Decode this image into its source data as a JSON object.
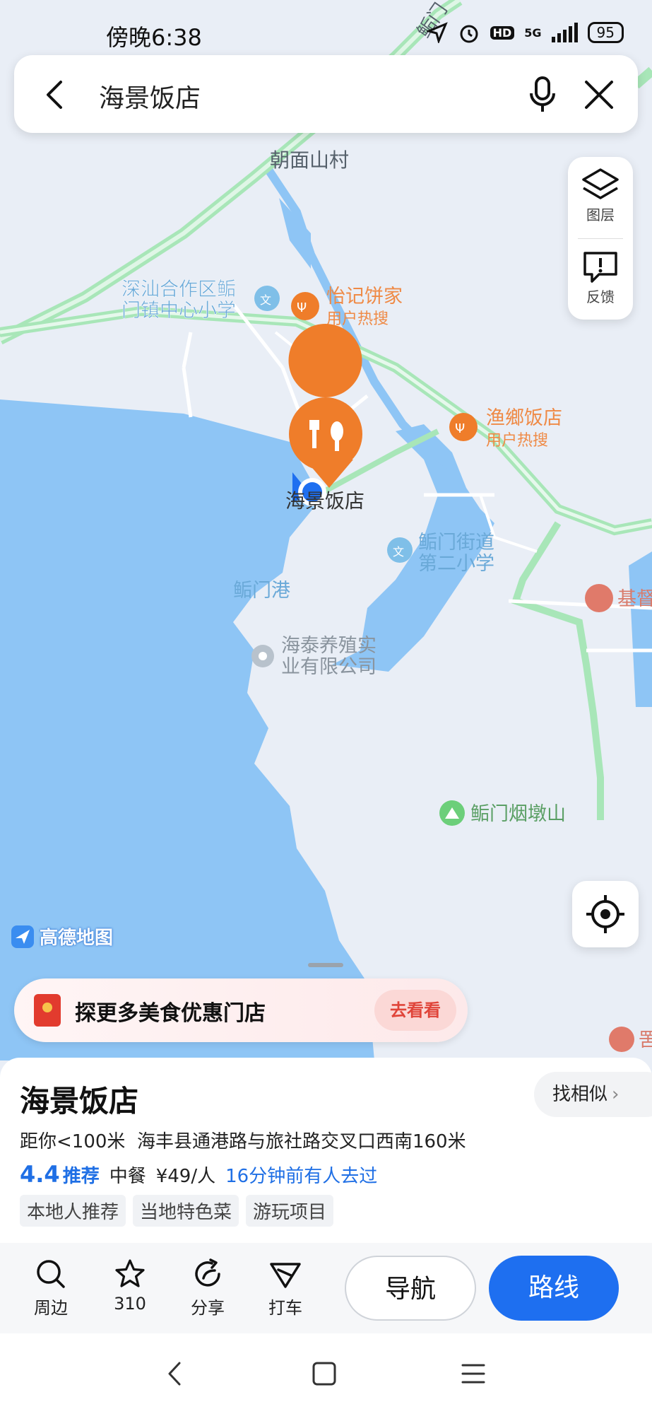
{
  "status_bar": {
    "time": "傍晚6:38",
    "network": "5G",
    "hd": "HD",
    "battery": "95"
  },
  "search": {
    "query": "海景饭店"
  },
  "map": {
    "labels": {
      "village": "朝面山村",
      "school1": "深汕合作区鲘\n门镇中心小学",
      "yiji": "怡记饼家",
      "yiji_sub": "用户热搜",
      "yuxiang": "渔鄉饭店",
      "yuxiang_sub": "用户热搜",
      "haijing": "海景饭店",
      "school2": "鲘门街道\n第二小学",
      "port": "鲘门港",
      "company": "海泰养殖实\n业有限公司",
      "mountain": "鲘门烟墩山",
      "edge_right": "基督",
      "edge_bottom": "罟",
      "road_top": "鲘门"
    },
    "colors": {
      "water": "#8ec5f5",
      "land": "#e9eef6",
      "road": "#a8e6b8",
      "poi": "#ef7d2a",
      "accent": "#1e6ff0"
    }
  },
  "side_panel": {
    "layers": "图层",
    "feedback": "反馈"
  },
  "logo": "高德地图",
  "promo": {
    "text": "探更多美食优惠门店",
    "button": "去看看"
  },
  "place": {
    "name": "海景饭店",
    "similar": "找相似",
    "distance": "距你<100米",
    "address": "海丰县通港路与旅社路交叉口西南160米",
    "rating": "4.4",
    "rating_label": "推荐",
    "category": "中餐",
    "price": "¥49/人",
    "recent": "16分钟前有人去过",
    "tags": [
      "本地人推荐",
      "当地特色菜",
      "游玩项目"
    ]
  },
  "actions": {
    "nearby": "周边",
    "favorite": "310",
    "share": "分享",
    "taxi": "打车",
    "navigate": "导航",
    "route": "路线"
  }
}
